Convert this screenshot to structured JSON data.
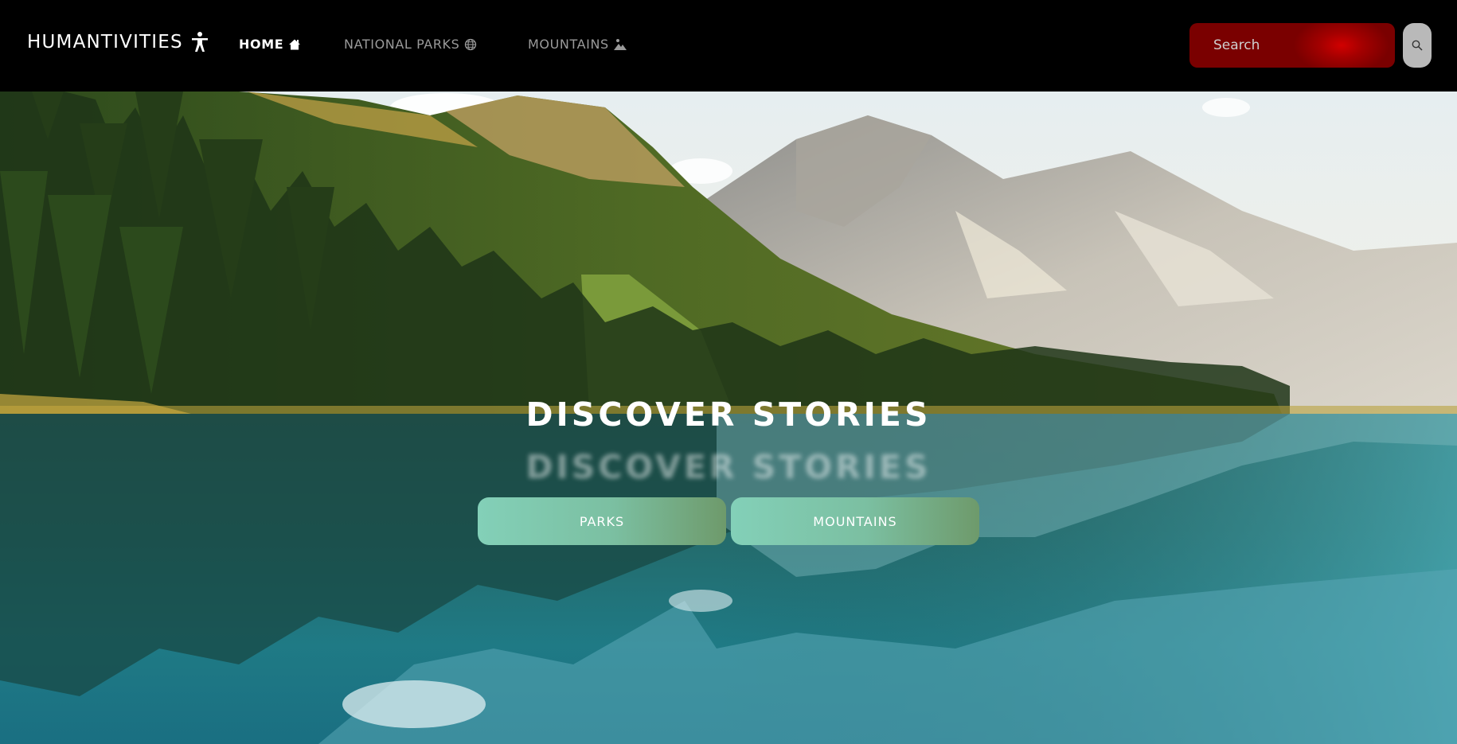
{
  "navbar": {
    "brand": "HUMANTIVITIES",
    "brand_icon": "accessibility-person-icon",
    "links": [
      {
        "label": "HOME",
        "icon": "home-icon",
        "active": true
      },
      {
        "label": "NATIONAL PARKS",
        "icon": "globe-icon",
        "active": false
      },
      {
        "label": "MOUNTAINS",
        "icon": "mountain-person-icon",
        "active": false
      }
    ],
    "search": {
      "placeholder": "Search",
      "button_icon": "search-icon"
    }
  },
  "hero": {
    "title": "DISCOVER STORIES",
    "reflection": "DISCOVER STORIES",
    "buttons": [
      {
        "label": "PARKS"
      },
      {
        "label": "MOUNTAINS"
      }
    ]
  },
  "colors": {
    "navbar_bg": "#000000",
    "search_bg": "#a30000",
    "search_button_bg": "#b9b9b9",
    "cta_gradient_start": "#83d0b8",
    "cta_gradient_end": "#6e9a6b",
    "active_link": "#ffffff",
    "inactive_link": "#9a9a9a"
  }
}
